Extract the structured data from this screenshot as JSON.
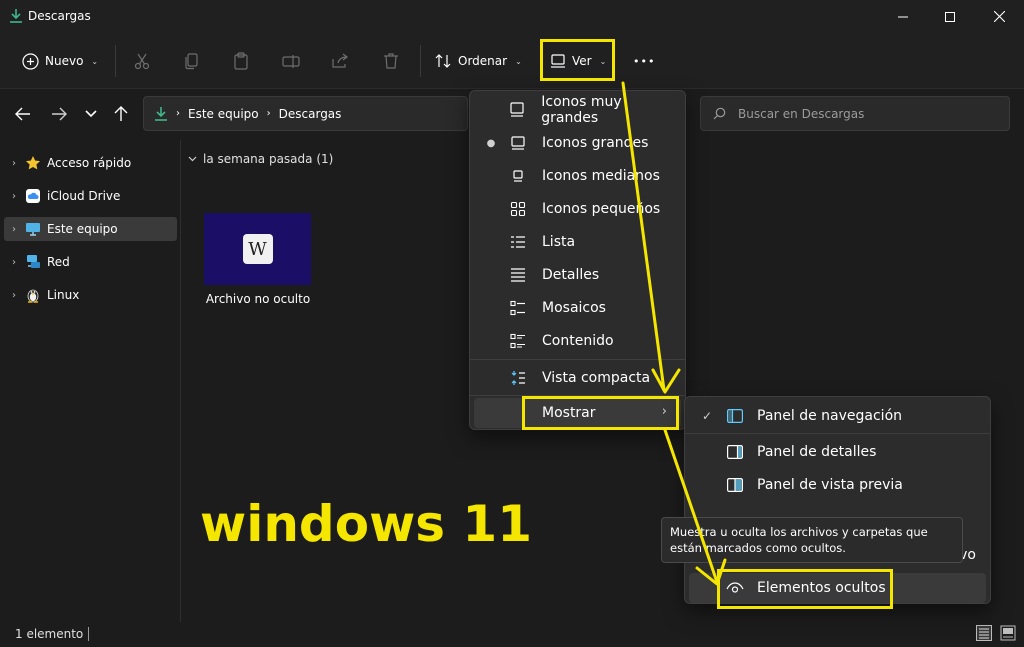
{
  "window": {
    "title": "Descargas",
    "min_icon": "minimize-icon",
    "max_icon": "maximize-icon",
    "close_icon": "close-icon"
  },
  "toolbar": {
    "new_label": "Nuevo",
    "sort_label": "Ordenar",
    "view_label": "Ver",
    "more_label": "•••"
  },
  "address": {
    "segments": [
      "Este equipo",
      "Descargas"
    ],
    "search_placeholder": "Buscar en Descargas"
  },
  "sidebar": {
    "items": [
      {
        "label": "Acceso rápido",
        "icon": "star-icon"
      },
      {
        "label": "iCloud Drive",
        "icon": "icloud-icon"
      },
      {
        "label": "Este equipo",
        "icon": "computer-icon"
      },
      {
        "label": "Red",
        "icon": "network-icon"
      },
      {
        "label": "Linux",
        "icon": "linux-icon"
      }
    ]
  },
  "content": {
    "group_header": "la semana pasada (1)",
    "file_name": "Archivo no oculto",
    "thumb_letter": "W"
  },
  "status": {
    "count": "1 elemento"
  },
  "view_menu": {
    "items": [
      {
        "label": "Iconos muy grandes",
        "icon": "monitor-icon"
      },
      {
        "label": "Iconos grandes",
        "icon": "monitor-icon",
        "selected": true
      },
      {
        "label": "Iconos medianos",
        "icon": "monitor-small-icon"
      },
      {
        "label": "Iconos pequeños",
        "icon": "grid-icon"
      },
      {
        "label": "Lista",
        "icon": "list-icon"
      },
      {
        "label": "Detalles",
        "icon": "details-icon"
      },
      {
        "label": "Mosaicos",
        "icon": "tiles-icon"
      },
      {
        "label": "Contenido",
        "icon": "content-icon"
      },
      {
        "label": "Vista compacta",
        "icon": "compact-icon"
      },
      {
        "label": "Mostrar",
        "icon": "",
        "submenu": true
      }
    ]
  },
  "show_menu": {
    "items": [
      {
        "label": "Panel de navegación",
        "checked": true,
        "icon": "nav-pane-icon"
      },
      {
        "label": "Panel de detalles",
        "icon": "details-pane-icon"
      },
      {
        "label": "Panel de vista previa",
        "icon": "preview-pane-icon"
      },
      {
        "label": "vo",
        "icon": ""
      },
      {
        "label": "Elementos ocultos",
        "icon": "eye-icon"
      }
    ]
  },
  "tooltip": {
    "text": "Muestra u oculta los archivos y carpetas que están marcados como ocultos."
  },
  "annotation": {
    "watermark": "windows 11",
    "highlight_color": "#f5e600"
  },
  "colors": {
    "accent": "#60cdff",
    "background": "#1c1c1c",
    "menu": "#2c2c2c"
  }
}
